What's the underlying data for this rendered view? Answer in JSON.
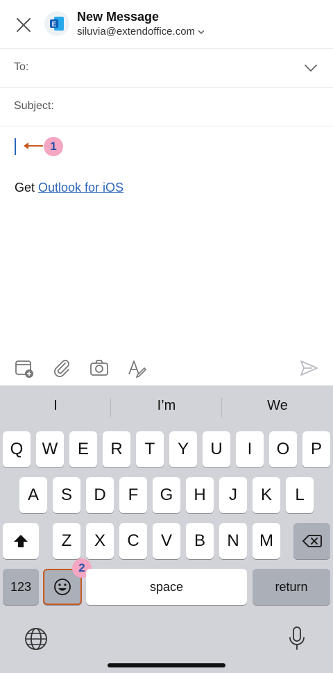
{
  "header": {
    "close_icon": "close-icon",
    "account_icon": "exchange-icon",
    "title": "New Message",
    "account": "siluvia@extendoffice.com"
  },
  "fields": {
    "to_label": "To:",
    "to_value": "",
    "subject_label": "Subject:",
    "subject_value": ""
  },
  "body": {
    "text": "",
    "signature_prefix": "Get ",
    "signature_link": "Outlook for iOS"
  },
  "annotations": {
    "marker1": "1",
    "marker2": "2",
    "marker_color": "#f4a6c2",
    "marker_text_color": "#2950a8",
    "arrow_color": "#c8581f"
  },
  "toolbar": {
    "icons": [
      "calendar-add-icon",
      "attachment-icon",
      "camera-icon",
      "pen-format-icon",
      "send-icon"
    ]
  },
  "keyboard": {
    "suggestions": [
      "I",
      "I’m",
      "We"
    ],
    "row1": [
      "Q",
      "W",
      "E",
      "R",
      "T",
      "Y",
      "U",
      "I",
      "O",
      "P"
    ],
    "row2": [
      "A",
      "S",
      "D",
      "F",
      "G",
      "H",
      "J",
      "K",
      "L"
    ],
    "row3": [
      "Z",
      "X",
      "C",
      "V",
      "B",
      "N",
      "M"
    ],
    "shift_icon": "shift-icon",
    "backspace_icon": "backspace-icon",
    "numbers_label": "123",
    "emoji_icon": "emoji-icon",
    "space_label": "space",
    "return_label": "return",
    "globe_icon": "globe-icon",
    "mic_icon": "microphone-icon"
  },
  "colors": {
    "link": "#2b66b8",
    "keyboard_bg": "#d1d3d9",
    "key_dark": "#abafb8"
  }
}
